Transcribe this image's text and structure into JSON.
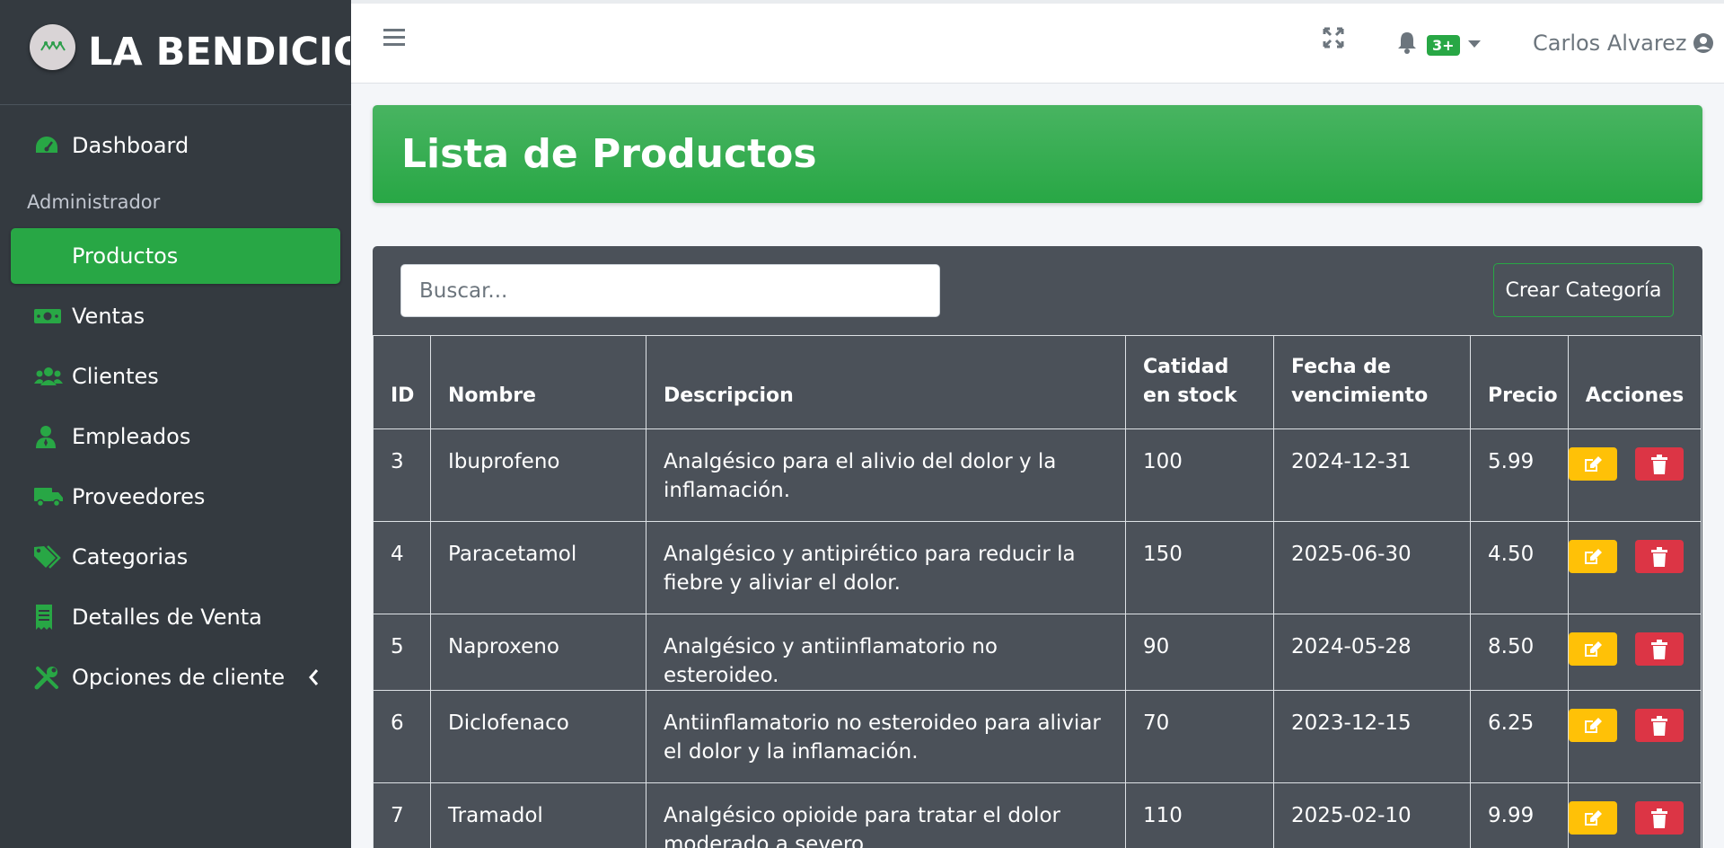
{
  "brand": {
    "name": "LA BENDICION"
  },
  "sidebar": {
    "items": [
      {
        "label": "Dashboard",
        "icon": "tachometer-icon"
      },
      {
        "header": "Administrador"
      },
      {
        "label": "Productos",
        "active": true
      },
      {
        "label": "Ventas",
        "icon": "money-icon"
      },
      {
        "label": "Clientes",
        "icon": "users-icon"
      },
      {
        "label": "Empleados",
        "icon": "user-tie-icon"
      },
      {
        "label": "Proveedores",
        "icon": "truck-icon"
      },
      {
        "label": "Categorias",
        "icon": "tags-icon"
      },
      {
        "label": "Detalles de Venta",
        "icon": "receipt-icon"
      },
      {
        "label": "Opciones de cliente",
        "icon": "tools-icon"
      }
    ]
  },
  "topbar": {
    "notifications_badge": "3+",
    "user_name": "Carlos Alvarez"
  },
  "page": {
    "title": "Lista de Productos"
  },
  "toolbar": {
    "search_placeholder": "Buscar...",
    "create_label": "Crear Categoría"
  },
  "table": {
    "headers": [
      "ID",
      "Nombre",
      "Descripcion",
      "Catidad en stock",
      "Fecha de vencimiento",
      "Precio",
      "Acciones"
    ],
    "rows": [
      {
        "id": "3",
        "nombre": "Ibuprofeno",
        "descripcion": "Analgésico para el alivio del dolor y la inflamación.",
        "stock": "100",
        "fecha": "2024-12-31",
        "precio": "5.99"
      },
      {
        "id": "4",
        "nombre": "Paracetamol",
        "descripcion": "Analgésico y antipirético para reducir la fiebre y aliviar el dolor.",
        "stock": "150",
        "fecha": "2025-06-30",
        "precio": "4.50"
      },
      {
        "id": "5",
        "nombre": "Naproxeno",
        "descripcion": "Analgésico y antiinflamatorio no esteroideo.",
        "stock": "90",
        "fecha": "2024-05-28",
        "precio": "8.50"
      },
      {
        "id": "6",
        "nombre": "Diclofenaco",
        "descripcion": "Antiinflamatorio no esteroideo para aliviar el dolor y la inflamación.",
        "stock": "70",
        "fecha": "2023-12-15",
        "precio": "6.25"
      },
      {
        "id": "7",
        "nombre": "Tramadol",
        "descripcion": "Analgésico opioide para tratar el dolor moderado a severo.",
        "stock": "110",
        "fecha": "2025-02-10",
        "precio": "9.99"
      }
    ]
  },
  "colors": {
    "accent": "#28a745",
    "sidebar": "#343a40",
    "card": "#4b5159",
    "edit": "#ffc107",
    "delete": "#dc3545"
  }
}
